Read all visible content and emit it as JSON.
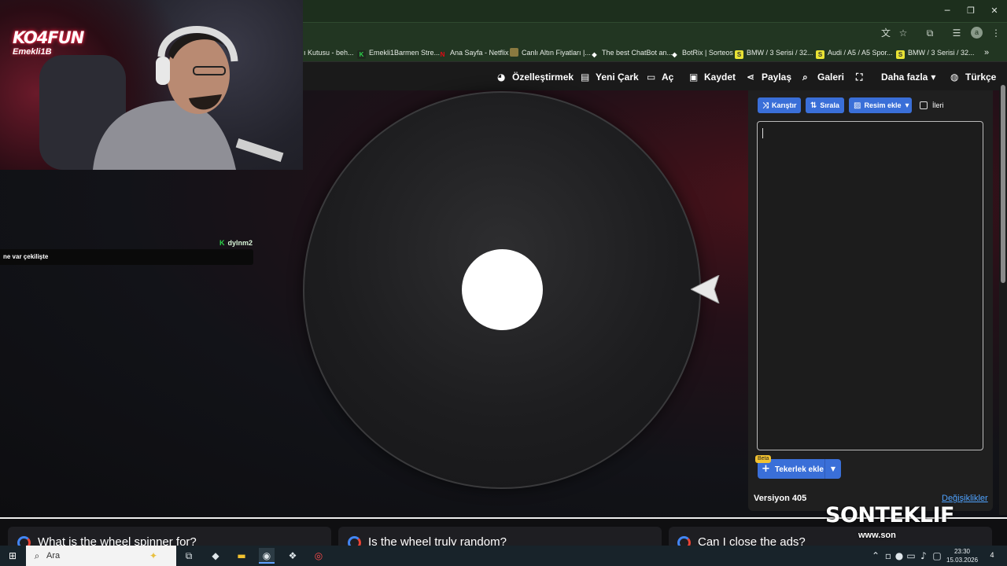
{
  "browser": {
    "bookmarks": [
      {
        "label": "ı Kutusu - beh...",
        "icon": "none"
      },
      {
        "label": "Emekli1Barmen Stre...",
        "icon": "kick"
      },
      {
        "label": "Ana Sayfa - Netflix",
        "icon": "netflix"
      },
      {
        "label": "Canlı Altın Fiyatları |...",
        "icon": "gold"
      },
      {
        "label": "The best ChatBot an...",
        "icon": "diamond"
      },
      {
        "label": "BotRix | Sorteos",
        "icon": "diamond"
      },
      {
        "label": "BMW / 3 Serisi / 32...",
        "icon": "sahibinden"
      },
      {
        "label": "Audi / A5 / A5 Spor...",
        "icon": "sahibinden"
      },
      {
        "label": "BMW / 3 Serisi / 32...",
        "icon": "sahibinden"
      }
    ],
    "bookmarks_more": "»",
    "profile_initial": "a"
  },
  "site_nav": {
    "customize": "Özelleştirmek",
    "new_wheel": "Yeni Çark",
    "open": "Aç",
    "save": "Kaydet",
    "share": "Paylaş",
    "gallery": "Galeri",
    "more": "Daha fazla",
    "language": "Türkçe"
  },
  "panel": {
    "shuffle": "Karıştır",
    "sort": "Sırala",
    "add_image": "Resim ekle",
    "advanced": "İleri",
    "entries_text": "",
    "beta_badge": "Beta",
    "add_wheel": "Tekerlek ekle",
    "version": "Versiyon 405",
    "changes_link": "Değişiklikler"
  },
  "stream": {
    "cam_logo": "KO4FUN",
    "cam_sub": "Emekli1B",
    "chat_user": "dylnm2",
    "chat_message": "ne var çekilişte",
    "brand": "SONTEKLIF",
    "brand_url": "www.son"
  },
  "faq": [
    {
      "text": "What is the wheel spinner for?"
    },
    {
      "text": "Is the wheel truly random?"
    },
    {
      "text": "Can I close the ads?"
    }
  ],
  "taskbar": {
    "search_placeholder": "Ara",
    "time": "23:30",
    "date": "15.03.2026",
    "notification_count": "4"
  },
  "colors": {
    "accent": "#3a6fd8",
    "link": "#4fa3ff",
    "beta": "#f2c230",
    "kick_green": "#2bd24a"
  }
}
